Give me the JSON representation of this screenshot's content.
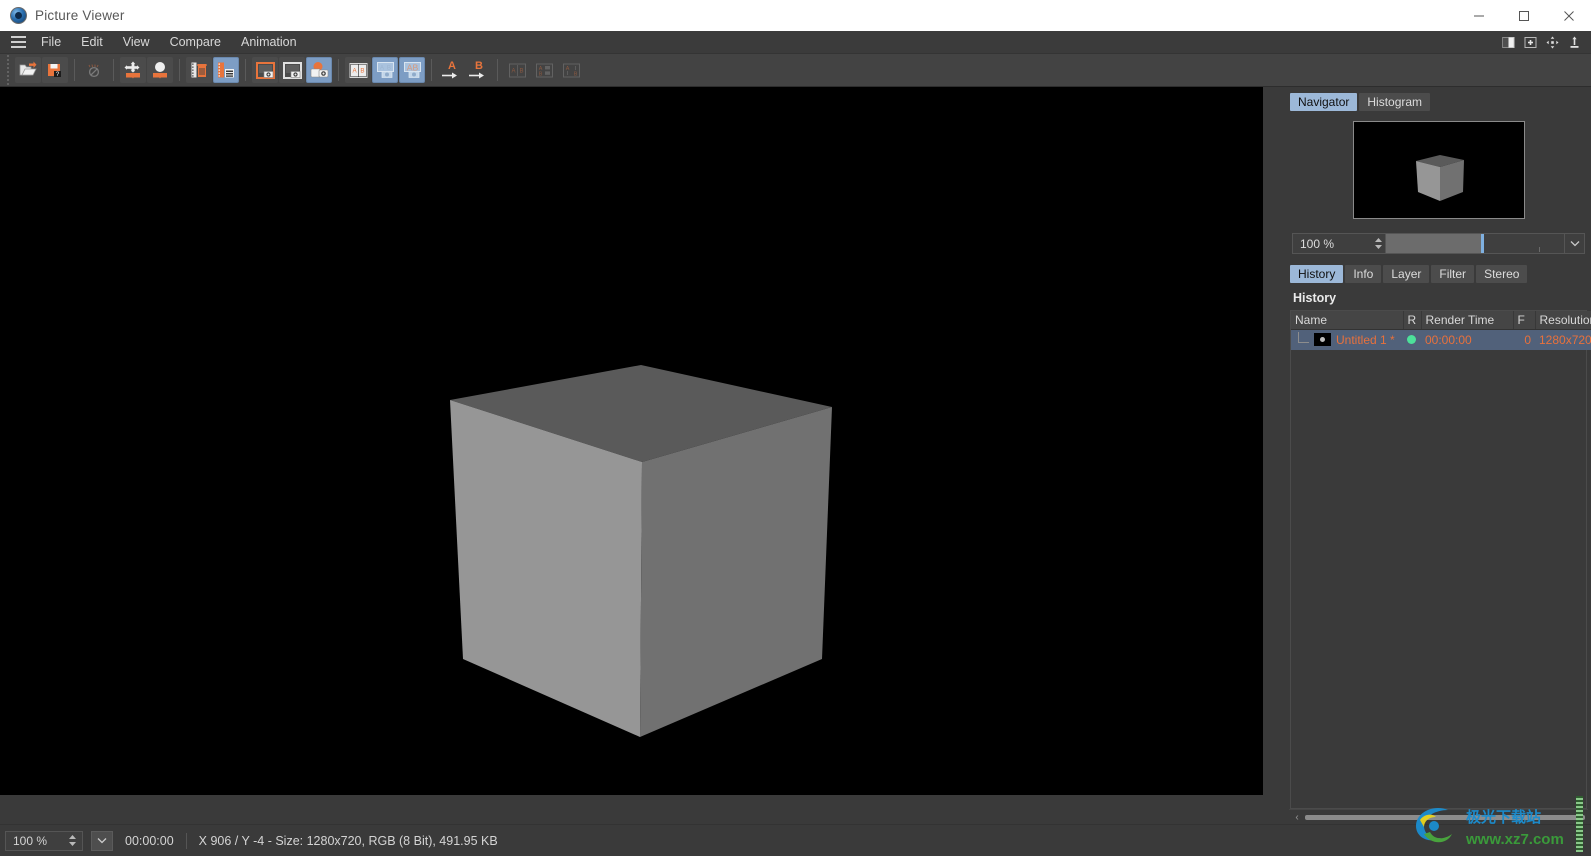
{
  "window": {
    "title": "Picture Viewer",
    "logo_icon": "cinema4d-logo-icon",
    "controls": {
      "minimize": "minimize-icon",
      "maximize": "maximize-icon",
      "close": "close-icon"
    }
  },
  "menubar": {
    "hamburger_icon": "hamburger-menu-icon",
    "items": [
      {
        "label": "File"
      },
      {
        "label": "Edit"
      },
      {
        "label": "View"
      },
      {
        "label": "Compare"
      },
      {
        "label": "Animation"
      }
    ],
    "right_icons": [
      {
        "name": "split-layout-icon"
      },
      {
        "name": "add-panel-icon"
      },
      {
        "name": "move-panel-icon"
      },
      {
        "name": "dock-panel-icon"
      }
    ]
  },
  "toolbar": {
    "groups": [
      {
        "buttons": [
          {
            "name": "open-image-button",
            "icon": "folder-open-icon",
            "state": "normal"
          },
          {
            "name": "save-image-button",
            "icon": "save-question-icon",
            "state": "normal"
          }
        ]
      },
      {
        "buttons": [
          {
            "name": "clear-render-button",
            "icon": "no-entry-icon",
            "state": "disabled"
          }
        ]
      },
      {
        "buttons": [
          {
            "name": "move-to-picture-button",
            "icon": "move-down-icon",
            "state": "normal"
          },
          {
            "name": "render-to-picture-button",
            "icon": "sphere-down-icon",
            "state": "normal"
          }
        ]
      },
      {
        "buttons": [
          {
            "name": "delete-frame-button",
            "icon": "filmstrip-trash-icon",
            "state": "normal"
          },
          {
            "name": "filmstrip-button",
            "icon": "filmstrip-layers-icon",
            "state": "active"
          }
        ]
      },
      {
        "buttons": [
          {
            "name": "set-a-image-button",
            "icon": "frame-a-icon",
            "state": "normal"
          },
          {
            "name": "set-b-image-button",
            "icon": "frame-b-icon",
            "state": "normal"
          },
          {
            "name": "compare-ab-button",
            "icon": "compare-overlay-icon",
            "state": "active"
          }
        ]
      },
      {
        "buttons": [
          {
            "name": "ab-side-by-side-button",
            "icon": "ab-split-icon",
            "state": "normal"
          },
          {
            "name": "ab-single-a-button",
            "icon": "ab-single-a-icon",
            "state": "active"
          },
          {
            "name": "ab-single-b-button",
            "icon": "ab-single-b-icon",
            "state": "active"
          }
        ]
      },
      {
        "buttons": [
          {
            "name": "assign-a-button",
            "icon": "a-arrow-icon",
            "state": "normal"
          },
          {
            "name": "assign-b-button",
            "icon": "b-arrow-icon",
            "state": "normal"
          }
        ]
      },
      {
        "buttons": [
          {
            "name": "swap-ab-button",
            "icon": "swap-ab-icon",
            "state": "disabled"
          },
          {
            "name": "ab-grid-button",
            "icon": "ab-grid-icon",
            "state": "disabled"
          },
          {
            "name": "ab-stack-button",
            "icon": "ab-stack-icon",
            "state": "disabled"
          }
        ]
      }
    ]
  },
  "viewport": {
    "background_color": "#000000",
    "scene": {
      "object": "cube",
      "top_face_color": "#5a5a5a",
      "left_face_color": "#969696",
      "right_face_color": "#717171"
    }
  },
  "navigator_panel": {
    "tabs": [
      {
        "label": "Navigator",
        "selected": true
      },
      {
        "label": "Histogram",
        "selected": false
      }
    ],
    "zoom": {
      "value": "100 %",
      "slider_position_pct": 48,
      "dropdown_icon": "chevron-down-icon",
      "spinner_icon": "spinner-updown-icon"
    }
  },
  "history_panel": {
    "tabs": [
      {
        "label": "History",
        "selected": true
      },
      {
        "label": "Info",
        "selected": false
      },
      {
        "label": "Layer",
        "selected": false
      },
      {
        "label": "Filter",
        "selected": false
      },
      {
        "label": "Stereo",
        "selected": false
      }
    ],
    "heading": "History",
    "columns": [
      "Name",
      "R",
      "Render Time",
      "F",
      "Resolution"
    ],
    "rows": [
      {
        "name": "Untitled 1 *",
        "r": "render-status-dot",
        "render_time": "00:00:00",
        "f": "0",
        "resolution": "1280x720",
        "selected": true,
        "thumb_icon": "render-thumbnail-icon"
      }
    ],
    "scroll_left_icon": "chevron-left-icon"
  },
  "statusbar": {
    "zoom_value": "100 %",
    "zoom_spinner_icon": "spinner-updown-icon",
    "zoom_dropdown_icon": "chevron-down-icon",
    "time": "00:00:00",
    "info": "X 906 / Y -4 - Size: 1280x720, RGB (8 Bit), 491.95 KB"
  },
  "watermark": {
    "site": "www.xz7.com",
    "logo_icon": "aurora-download-logo-icon"
  },
  "colors": {
    "accent_blue": "#9cb8d8",
    "accent_orange": "#e8713c",
    "panel_bg": "#3a3a3a",
    "toolbar_bg": "#434343",
    "status_green": "#4de09a"
  }
}
